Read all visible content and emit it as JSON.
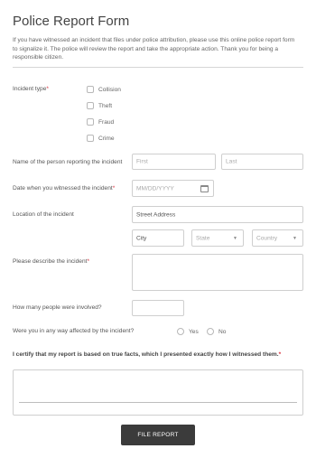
{
  "form": {
    "title": "Police Report Form",
    "description": "If you have witnessed an incident that files under police attribution, please use this online police report form to signalize it. The police will review the report and take the appropriate action. Thank you for being a responsible citizen.",
    "required_mark": "*"
  },
  "incident_type": {
    "label": "Incident type",
    "options": [
      "Collision",
      "Theft",
      "Fraud",
      "Crime"
    ]
  },
  "reporter_name": {
    "label": "Name of the person reporting the incident",
    "first_placeholder": "First",
    "last_placeholder": "Last"
  },
  "witness_date": {
    "label": "Date when you witnessed the incident",
    "placeholder": "MM/DD/YYYY"
  },
  "location": {
    "label": "Location of the incident",
    "street_placeholder": "Street Address",
    "city_placeholder": "City",
    "state_placeholder": "State",
    "country_placeholder": "Country"
  },
  "describe": {
    "label": "Please describe the incident"
  },
  "people_involved": {
    "label": "How many people were involved?"
  },
  "affected": {
    "label": "Were you in any way affected by the incident?",
    "options": [
      "Yes",
      "No"
    ]
  },
  "certify": {
    "label": "I certify that my report is based on true facts, which I presented exactly how I witnessed them."
  },
  "submit": {
    "label": "FILE REPORT"
  },
  "colors": {
    "required": "#d9333f",
    "button_bg": "#3b3b3b",
    "border": "#cfcfcf"
  }
}
